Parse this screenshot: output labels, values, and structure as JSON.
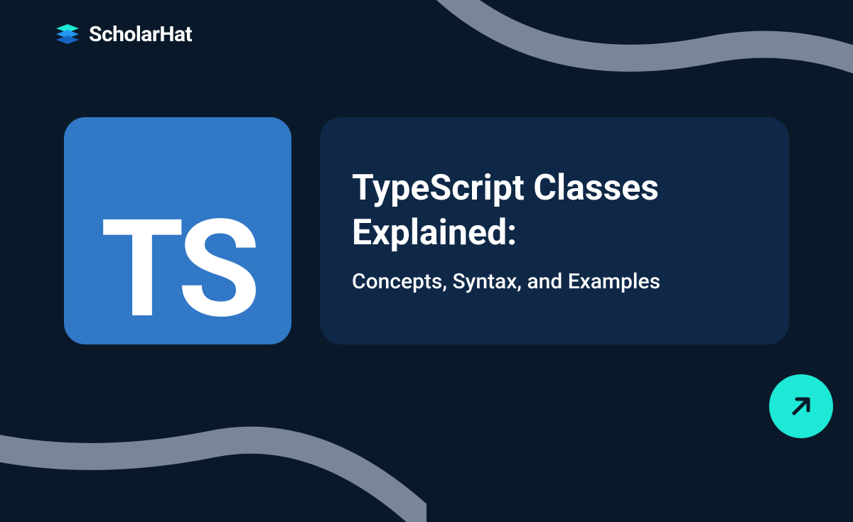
{
  "brand": {
    "name": "ScholarHat"
  },
  "badge": {
    "text": "TS"
  },
  "card": {
    "title": "TypeScript Classes Explained:",
    "subtitle": "Concepts, Syntax, and Examples"
  }
}
